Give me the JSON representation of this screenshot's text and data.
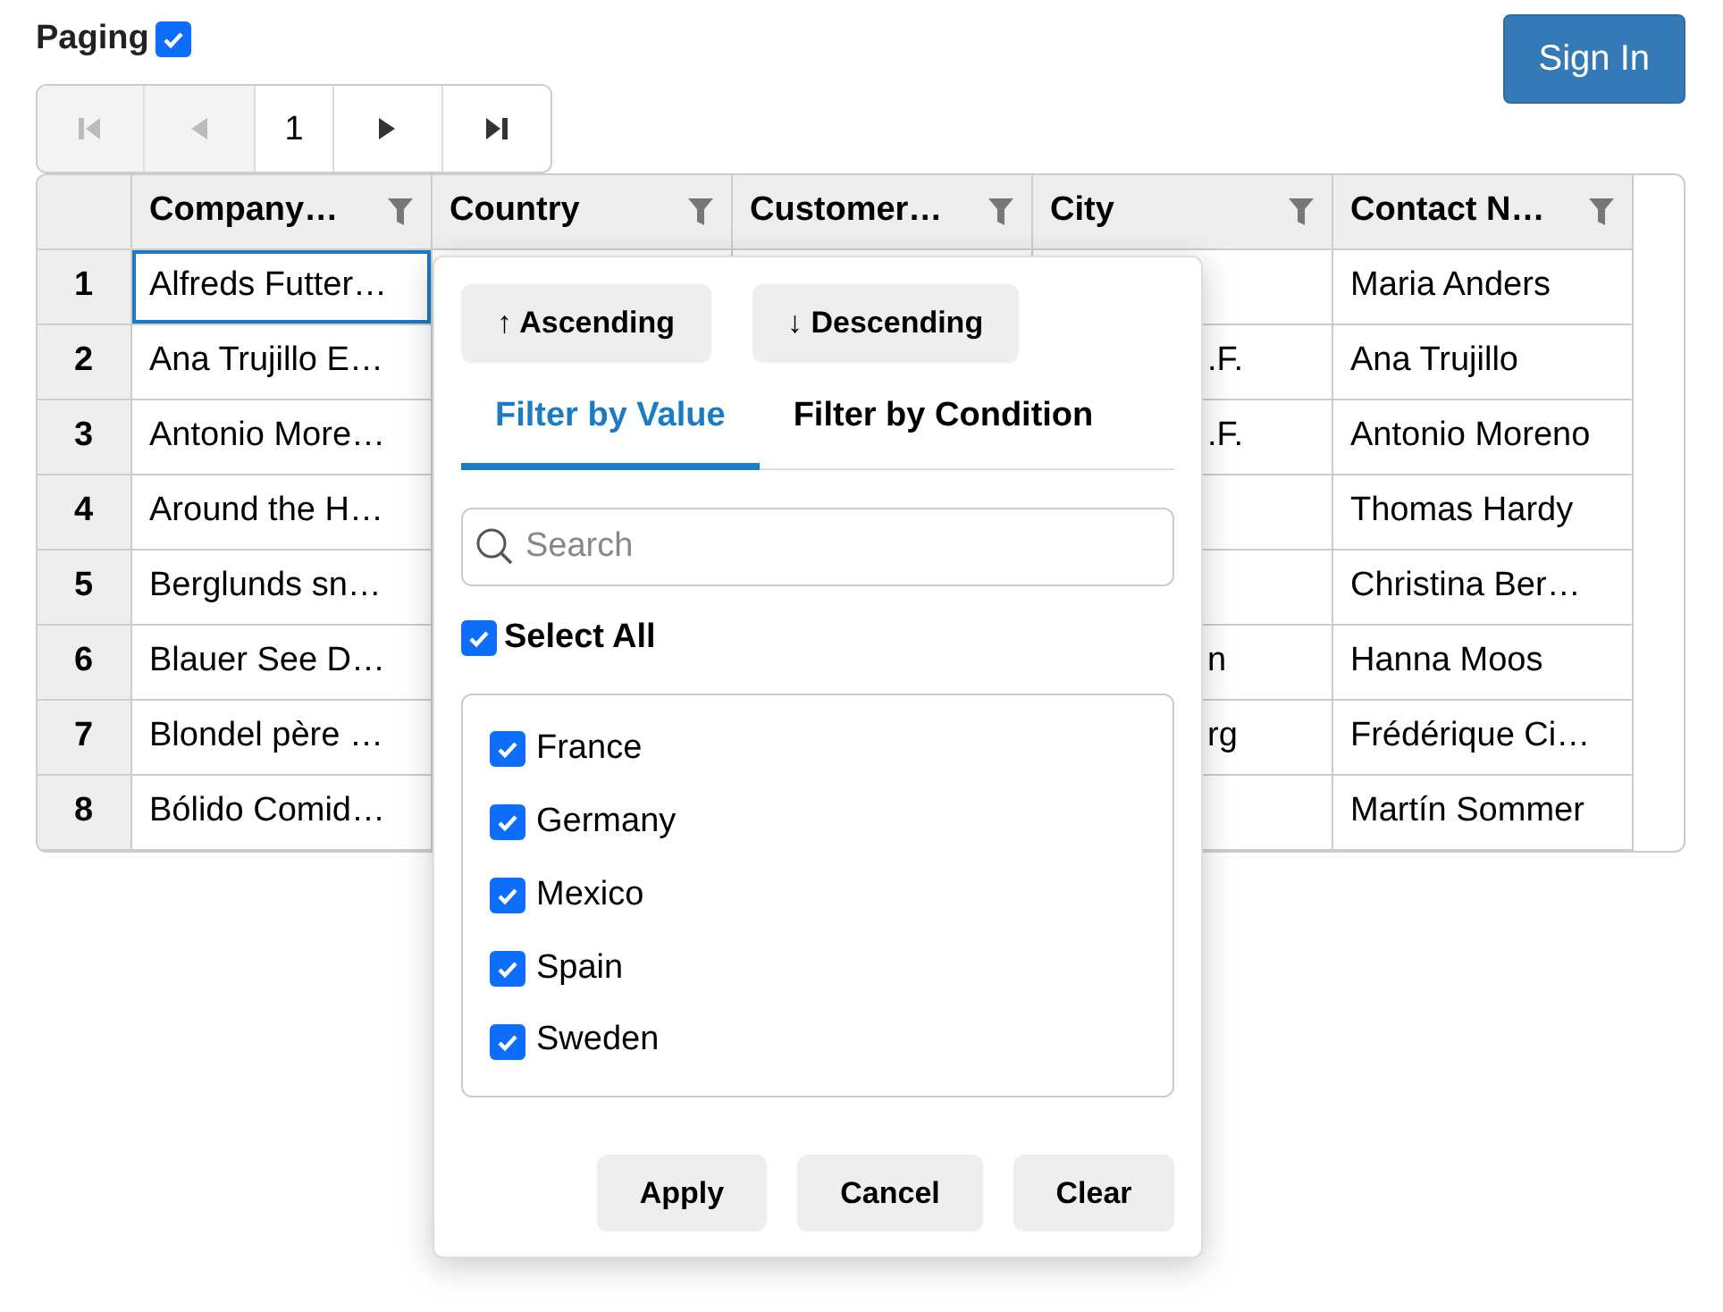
{
  "paging": {
    "label": "Paging",
    "checked": true
  },
  "sign_in": {
    "label": "Sign In"
  },
  "pager": {
    "page": "1",
    "buttons": [
      {
        "kind": "first",
        "disabled": true
      },
      {
        "kind": "prev",
        "disabled": true
      },
      {
        "kind": "next",
        "disabled": false
      },
      {
        "kind": "last",
        "disabled": false
      }
    ]
  },
  "grid": {
    "columns": [
      {
        "label": "Company…",
        "filter": true
      },
      {
        "label": "Country",
        "filter": true
      },
      {
        "label": "Customer…",
        "filter": true
      },
      {
        "label": "City",
        "filter": true
      },
      {
        "label": "Contact N…",
        "filter": true
      }
    ],
    "rows": [
      {
        "number": "1",
        "company": "Alfreds Futter…",
        "selected": true,
        "contact": "Maria Anders"
      },
      {
        "number": "2",
        "company": "Ana Trujillo E…",
        "selected": false,
        "city": ".F.",
        "contact": "Ana Trujillo"
      },
      {
        "number": "3",
        "company": "Antonio More…",
        "selected": false,
        "city": ".F.",
        "contact": "Antonio Moreno"
      },
      {
        "number": "4",
        "company": "Around the H…",
        "selected": false,
        "contact": "Thomas Hardy"
      },
      {
        "number": "5",
        "company": "Berglunds sn…",
        "selected": false,
        "contact": "Christina Ber…"
      },
      {
        "number": "6",
        "company": "Blauer See D…",
        "selected": false,
        "city": "n",
        "contact": "Hanna Moos"
      },
      {
        "number": "7",
        "company": "Blondel père …",
        "selected": false,
        "city": "rg",
        "contact": "Frédérique Ci…"
      },
      {
        "number": "8",
        "company": "Bólido Comid…",
        "selected": false,
        "contact": "Martín Sommer"
      }
    ]
  },
  "filter_popup": {
    "sort_buttons": [
      {
        "label": "↑ Ascending"
      },
      {
        "label": "↓ Descending"
      }
    ],
    "tabs": [
      {
        "label": "Filter by Value",
        "selected": true
      },
      {
        "label": "Filter by Condition",
        "selected": false
      }
    ],
    "search": {
      "placeholder": "Search"
    },
    "select_all": {
      "label": "Select All",
      "checked": true
    },
    "values": [
      {
        "label": "France",
        "checked": true
      },
      {
        "label": "Germany",
        "checked": true
      },
      {
        "label": "Mexico",
        "checked": true
      },
      {
        "label": "Spain",
        "checked": true
      },
      {
        "label": "Sweden",
        "checked": true
      }
    ],
    "buttons": [
      {
        "label": "Apply"
      },
      {
        "label": "Cancel"
      },
      {
        "label": "Clear"
      }
    ]
  }
}
